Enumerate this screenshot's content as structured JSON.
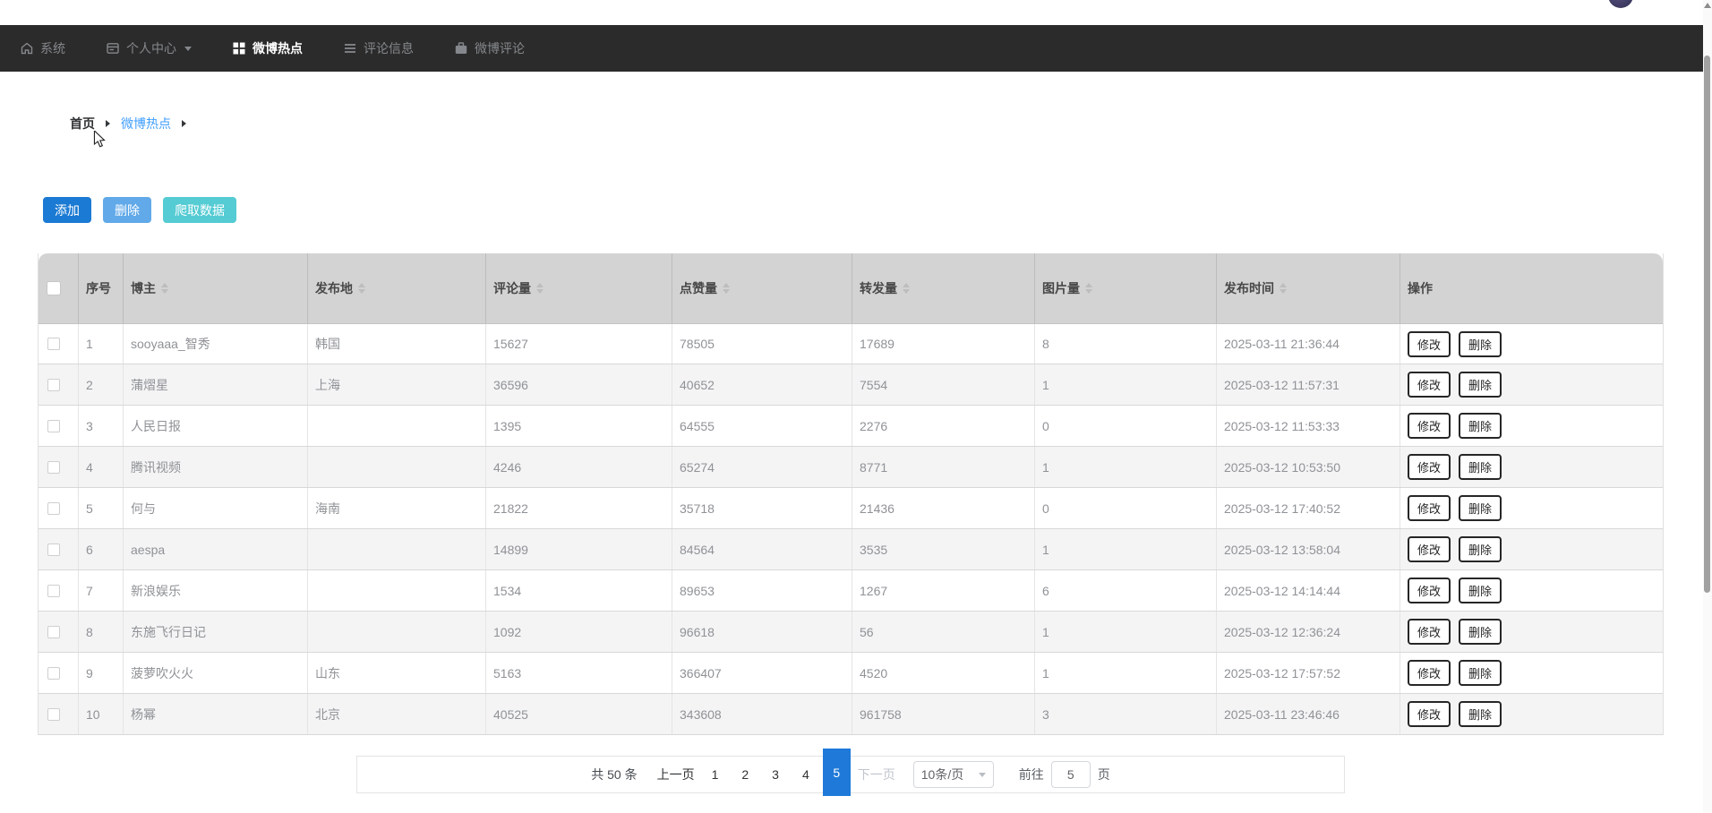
{
  "colors": {
    "navbar_bg": "#2b2b2b",
    "primary_blue": "#1b7ad3",
    "light_blue": "#61a9e9",
    "teal": "#55cbd3",
    "active_page_blue": "#1f79d8",
    "link_blue": "#409eff"
  },
  "navbar": {
    "items": [
      {
        "label": "系统",
        "icon": "home-icon",
        "active": false
      },
      {
        "label": "个人中心",
        "icon": "panel-icon",
        "active": false,
        "has_dropdown": true
      },
      {
        "label": "微博热点",
        "icon": "grid-icon",
        "active": true
      },
      {
        "label": "评论信息",
        "icon": "list-icon",
        "active": false
      },
      {
        "label": "微博评论",
        "icon": "briefcase-icon",
        "active": false
      }
    ]
  },
  "breadcrumb": {
    "items": [
      "首页",
      "微博热点"
    ]
  },
  "toolbar": {
    "buttons": [
      {
        "label": "添加",
        "color": "#1b7ad3"
      },
      {
        "label": "删除",
        "color": "#61a9e9"
      },
      {
        "label": "爬取数据",
        "color": "#55cbd3"
      }
    ]
  },
  "table": {
    "columns": [
      {
        "label": "序号",
        "sortable": false
      },
      {
        "label": "博主",
        "sortable": true
      },
      {
        "label": "发布地",
        "sortable": true
      },
      {
        "label": "评论量",
        "sortable": true
      },
      {
        "label": "点赞量",
        "sortable": true
      },
      {
        "label": "转发量",
        "sortable": true
      },
      {
        "label": "图片量",
        "sortable": true
      },
      {
        "label": "发布时间",
        "sortable": true
      },
      {
        "label": "操作",
        "sortable": false
      }
    ],
    "action_labels": {
      "edit": "修改",
      "delete": "删除"
    },
    "rows": [
      {
        "seq": "1",
        "blogger": "sooyaaa_智秀",
        "location": "韩国",
        "comments": "15627",
        "likes": "78505",
        "reposts": "17689",
        "images": "8",
        "time": "2025-03-11 21:36:44"
      },
      {
        "seq": "2",
        "blogger": "蒲熠星",
        "location": "上海",
        "comments": "36596",
        "likes": "40652",
        "reposts": "7554",
        "images": "1",
        "time": "2025-03-12 11:57:31"
      },
      {
        "seq": "3",
        "blogger": "人民日报",
        "location": "",
        "comments": "1395",
        "likes": "64555",
        "reposts": "2276",
        "images": "0",
        "time": "2025-03-12 11:53:33"
      },
      {
        "seq": "4",
        "blogger": "腾讯视频",
        "location": "",
        "comments": "4246",
        "likes": "65274",
        "reposts": "8771",
        "images": "1",
        "time": "2025-03-12 10:53:50"
      },
      {
        "seq": "5",
        "blogger": "何与",
        "location": "海南",
        "comments": "21822",
        "likes": "35718",
        "reposts": "21436",
        "images": "0",
        "time": "2025-03-12 17:40:52"
      },
      {
        "seq": "6",
        "blogger": "aespa",
        "location": "",
        "comments": "14899",
        "likes": "84564",
        "reposts": "3535",
        "images": "1",
        "time": "2025-03-12 13:58:04"
      },
      {
        "seq": "7",
        "blogger": "新浪娱乐",
        "location": "",
        "comments": "1534",
        "likes": "89653",
        "reposts": "1267",
        "images": "6",
        "time": "2025-03-12 14:14:44"
      },
      {
        "seq": "8",
        "blogger": "东施飞行日记",
        "location": "",
        "comments": "1092",
        "likes": "96618",
        "reposts": "56",
        "images": "1",
        "time": "2025-03-12 12:36:24"
      },
      {
        "seq": "9",
        "blogger": "菠萝吹火火",
        "location": "山东",
        "comments": "5163",
        "likes": "366407",
        "reposts": "4520",
        "images": "1",
        "time": "2025-03-12 17:57:52"
      },
      {
        "seq": "10",
        "blogger": "杨幂",
        "location": "北京",
        "comments": "40525",
        "likes": "343608",
        "reposts": "961758",
        "images": "3",
        "time": "2025-03-11 23:46:46"
      }
    ]
  },
  "pagination": {
    "total_text": "共 50 条",
    "prev_label": "上一页",
    "next_label": "下一页",
    "pages": [
      "1",
      "2",
      "3",
      "4",
      "5"
    ],
    "active_page": "5",
    "page_size": "10条/页",
    "goto_label": "前往",
    "goto_value": "5",
    "goto_suffix": "页"
  }
}
